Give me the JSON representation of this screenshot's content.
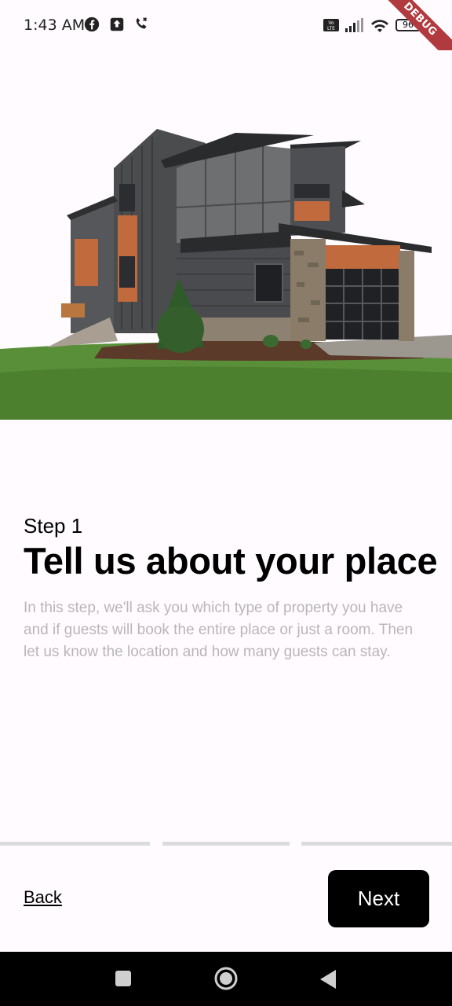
{
  "status_bar": {
    "time": "1:43 AM",
    "left_icons": [
      "facebook-icon",
      "upload-icon",
      "call-icon"
    ],
    "right_icons": [
      "volte-icon",
      "signal-icon",
      "wifi-icon",
      "battery-icon"
    ],
    "battery_level": "96",
    "debug_banner": "DEBUG"
  },
  "hero": {
    "image": "modern-house-illustration"
  },
  "content": {
    "step_label": "Step 1",
    "title": "Tell us about your place",
    "description": "In this step, we'll ask you which type of property you have and if guests will book the entire place or just a room. Then let us know the location and how many guests can stay."
  },
  "progress": {
    "segments": 3,
    "current_step": 1
  },
  "footer": {
    "back_label": "Back",
    "next_label": "Next"
  },
  "nav_bar": {
    "buttons": [
      "recents-icon",
      "home-icon",
      "back-icon"
    ]
  },
  "colors": {
    "background": "#fffbfe",
    "description_text": "#b9b6b9",
    "progress_track": "#dcdcdc",
    "primary_button": "#000000",
    "debug_ribbon": "#b13a3f"
  }
}
